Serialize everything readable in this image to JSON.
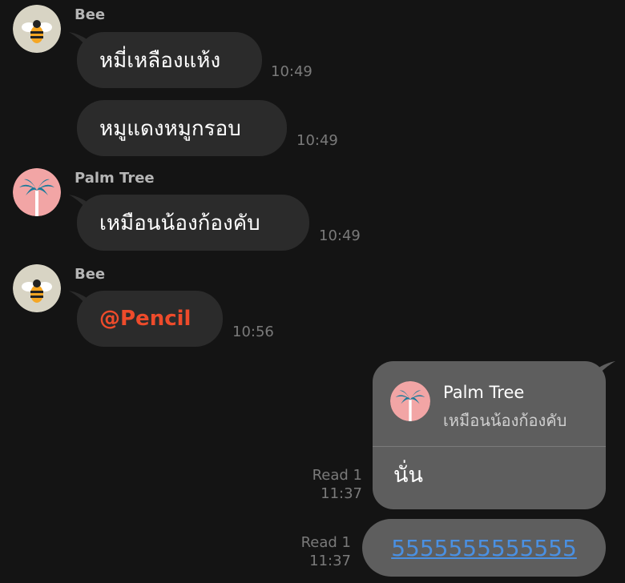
{
  "messages": [
    {
      "sender": "Bee",
      "text": "หมี่เหลืองแห้ง",
      "time": "10:49"
    },
    {
      "text": "หมูแดงหมูกรอบ",
      "time": "10:49"
    },
    {
      "sender": "Palm Tree",
      "text": "เหมือนน้องก้องคับ",
      "time": "10:49"
    },
    {
      "sender": "Bee",
      "text": "@Pencil",
      "time": "10:56"
    }
  ],
  "outgoing": [
    {
      "read": "Read 1",
      "time": "11:37",
      "reply_to": {
        "name": "Palm Tree",
        "text": "เหมือนน้องก้องคับ"
      },
      "text": "นั่น"
    },
    {
      "read": "Read 1",
      "time": "11:37",
      "text": "5555555555555"
    }
  ],
  "avatars": {
    "bee": {
      "icon": "bee-icon",
      "background": "#d8d4c4"
    },
    "palm_tree": {
      "icon": "palm-tree-icon",
      "background": "#f2a5a5"
    }
  },
  "colors": {
    "background": "#141414",
    "incoming_bubble": "#2b2b2b",
    "outgoing_bubble": "#5e5e5e",
    "mention": "#ee4b2b",
    "link": "#4a90e2",
    "timestamp": "#7a7a7a",
    "sender_name": "#b5b5b5"
  }
}
